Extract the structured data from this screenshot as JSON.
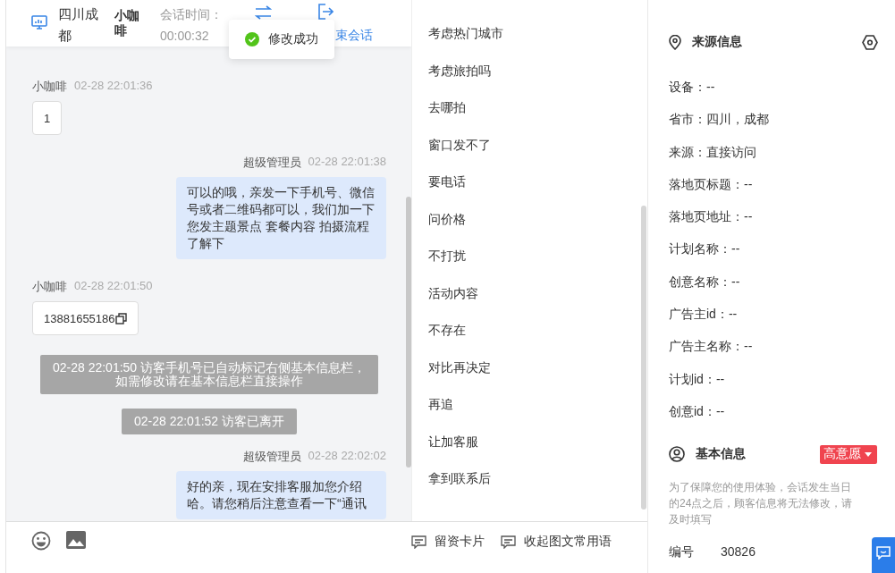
{
  "header": {
    "location": "四川成都",
    "visitor": "小咖啡",
    "duration_label": "会话时间：",
    "duration": "00:00:32",
    "end_label": "束会话"
  },
  "toast": {
    "text": "修改成功"
  },
  "messages": [
    {
      "kind": "visitor",
      "sender": "小咖啡",
      "time": "02-28 22:01:36",
      "text": "1",
      "copyable": false
    },
    {
      "kind": "agent",
      "sender": "超级管理员",
      "time": "02-28 22:01:38",
      "text": "可以的哦，亲发一下手机号、微信号或者二维码都可以，我们加一下您发主题景点 套餐内容 拍摄流程了解下"
    },
    {
      "kind": "visitor",
      "sender": "小咖啡",
      "time": "02-28 22:01:50",
      "text": "13881655186",
      "copyable": true
    },
    {
      "kind": "system",
      "lines": [
        "02-28 22:01:50 访客手机号已自动标记右侧基本信息栏，",
        "如需修改请在基本信息栏直接操作"
      ]
    },
    {
      "kind": "system",
      "lines": [
        "02-28 22:01:52 访客已离开"
      ]
    },
    {
      "kind": "agent",
      "sender": "超级管理员",
      "time": "02-28 22:02:02",
      "text": "好的亲，现在安排客服加您介绍哈。请您稍后注意查看一下“通讯"
    }
  ],
  "phrases": [
    "考虑热门城市",
    "考虑旅拍吗",
    "去哪拍",
    "窗口发不了",
    "要电话",
    "问价格",
    "不打扰",
    "活动内容",
    "不存在",
    "对比再决定",
    "再追",
    "让加客服",
    "拿到联系后"
  ],
  "toolbar": [
    "留资卡片",
    "收起图文常用语"
  ],
  "source_info": {
    "title": "来源信息",
    "fields": [
      "设备：--",
      "省市：四川，成都",
      "来源：直接访问",
      "落地页标题：--",
      "落地页地址：--",
      "计划名称：--",
      "创意名称：--",
      "广告主id：--",
      "广告主名称：--",
      "计划id：--",
      "创意id：--"
    ]
  },
  "basic_info": {
    "title": "基本信息",
    "intent": "高意愿",
    "notice": "为了保障您的使用体验，会话发生当日的24点之后，顾客信息将无法修改，请及时填写",
    "fields": [
      {
        "label": "编号",
        "value": "30826"
      }
    ]
  }
}
